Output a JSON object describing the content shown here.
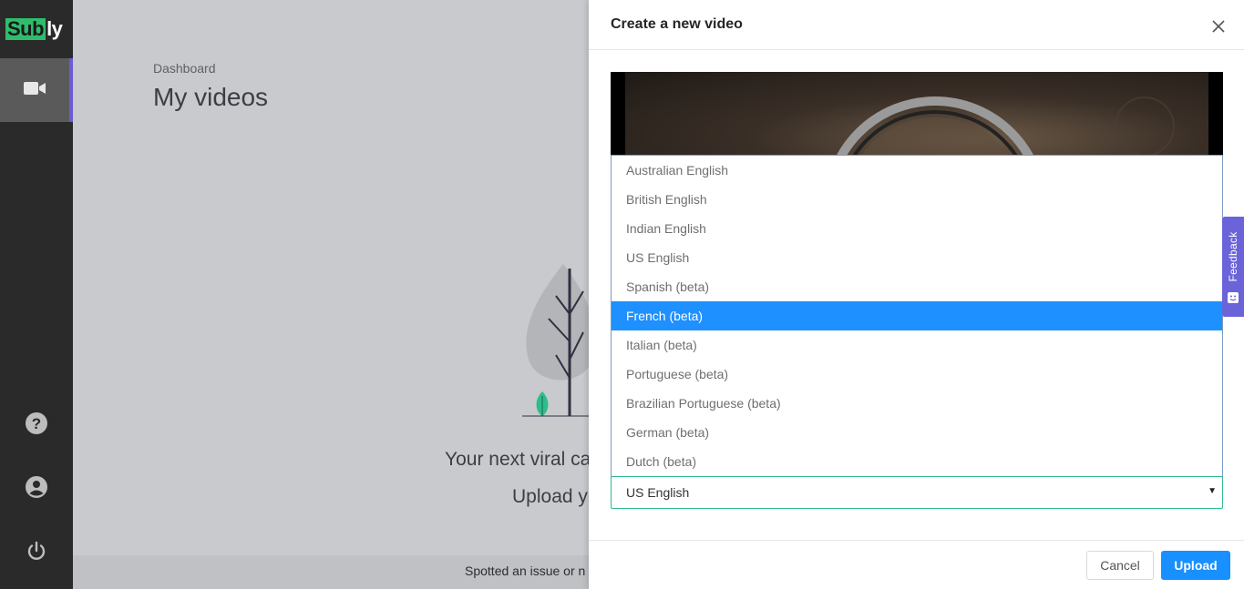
{
  "app": {
    "logo_highlight": "Sub",
    "logo_rest": "ly"
  },
  "sidebar": {
    "items": [
      {
        "name": "videos",
        "icon": "video-camera-icon",
        "active": true
      },
      {
        "name": "help",
        "icon": "help-circle-icon"
      },
      {
        "name": "account",
        "icon": "account-circle-icon"
      },
      {
        "name": "logout",
        "icon": "power-icon"
      }
    ]
  },
  "main": {
    "breadcrumb": "Dashboard",
    "title": "My videos",
    "empty_line_1": "Your next viral ca",
    "empty_line_2": "Upload y",
    "footer_text": "Spotted an issue or n"
  },
  "modal": {
    "title": "Create a new video",
    "language_options": [
      "Australian English",
      "British English",
      "Indian English",
      "US English",
      "Spanish (beta)",
      "French (beta)",
      "Italian (beta)",
      "Portuguese (beta)",
      "Brazilian Portuguese (beta)",
      "German (beta)",
      "Dutch (beta)"
    ],
    "highlighted_option": "French (beta)",
    "selected_value": "US English",
    "cancel_label": "Cancel",
    "upload_label": "Upload"
  },
  "feedback": {
    "label": "Feedback"
  },
  "colors": {
    "accent": "#1890ff",
    "brand_green": "#2ebd6b",
    "active_indicator": "#6b5bd6",
    "highlight_option": "#1e90ff"
  }
}
